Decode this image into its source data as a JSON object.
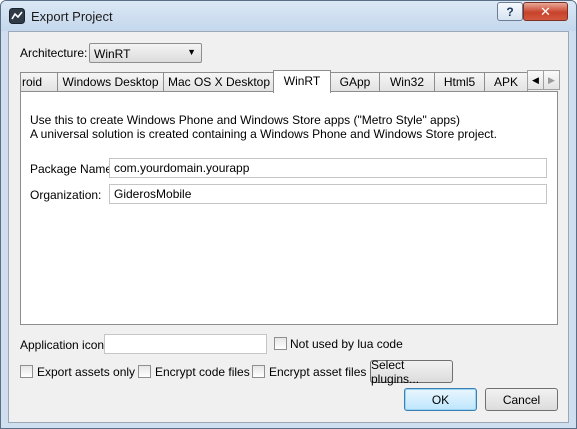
{
  "window": {
    "title": "Export Project",
    "help_label": "?",
    "close_label": "✕"
  },
  "architecture": {
    "label": "Architecture:",
    "selected": "WinRT"
  },
  "tabs": [
    "roid",
    "Windows Desktop",
    "Mac OS X Desktop",
    "WinRT",
    "GApp",
    "Win32",
    "Html5",
    "APK"
  ],
  "active_tab": "WinRT",
  "panel": {
    "description_line1": "Use this to create Windows Phone and Windows Store apps (\"Metro Style\" apps)",
    "description_line2": "A universal solution is created containing a Windows Phone and Windows Store project.",
    "package_name_label": "Package Name:",
    "package_name_value": "com.yourdomain.yourapp",
    "organization_label": "Organization:",
    "organization_value": "GiderosMobile"
  },
  "bottom": {
    "app_icon_label": "Application icon:",
    "app_icon_value": "",
    "not_used_label": "Not used by lua code",
    "export_assets_label": "Export assets only",
    "encrypt_code_label": "Encrypt code files",
    "encrypt_assets_label": "Encrypt asset files",
    "select_plugins_label": "Select plugins...",
    "ok_label": "OK",
    "cancel_label": "Cancel"
  }
}
